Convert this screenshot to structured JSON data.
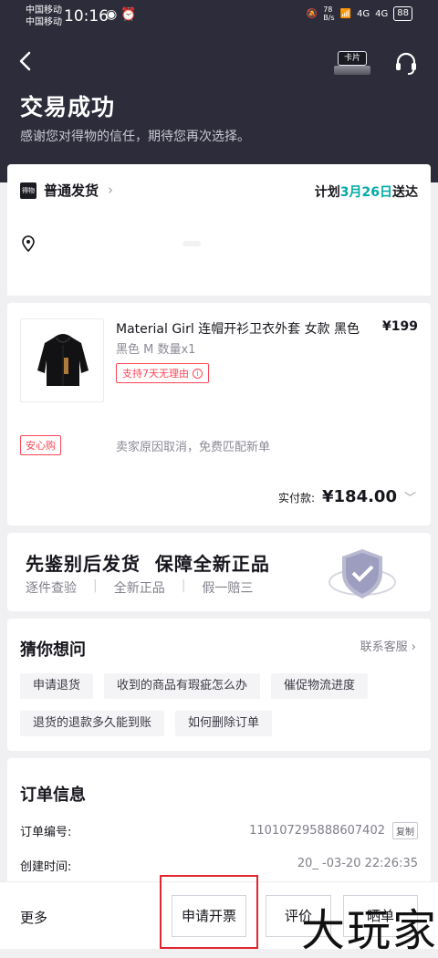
{
  "status_bar": {
    "carrier1": "中国移动",
    "carrier2": "中国移动",
    "time": "10:16",
    "net_speed": "78\nB/s",
    "signal1": "4G",
    "signal2": "4G",
    "battery": "88"
  },
  "header": {
    "title": "交易成功",
    "subtitle": "感谢您对得物的信任，期待您再次选择。",
    "card_label": "卡片"
  },
  "shipping": {
    "logo": "得物",
    "type": "普通发货",
    "plan_prefix": "计划",
    "plan_date": "3月26日",
    "plan_suffix": "送达"
  },
  "product": {
    "name": "Material Girl 连帽开衫卫衣外套 女款 黑色",
    "price": "¥199",
    "spec": "黑色 M 数量x1",
    "return_policy": "支持7天无理由",
    "safe_tag": "安心购",
    "safe_desc": "卖家原因取消，免费匹配新单",
    "paid_label": "实付款:",
    "paid_amount": "¥184.00"
  },
  "promise": {
    "title": "先鉴别后发货  保障全新正品",
    "items": [
      "逐件查验",
      "全新正品",
      "假一赔三"
    ]
  },
  "faq": {
    "title": "猜你想问",
    "link": "联系客服",
    "chips": [
      "申请退货",
      "收到的商品有瑕疵怎么办",
      "催促物流进度",
      "退货的退款多久能到账",
      "如何删除订单"
    ]
  },
  "order": {
    "title": "订单信息",
    "number_label": "订单编号:",
    "number_value": "110107295888607402",
    "copy": "复制",
    "created_label": "创建时间:",
    "created_value": "20_ -03-20 22:26:35"
  },
  "bottom": {
    "more": "更多",
    "invoice": "申请开票",
    "review": "评价",
    "third": "晒单"
  },
  "watermark": "大玩家"
}
